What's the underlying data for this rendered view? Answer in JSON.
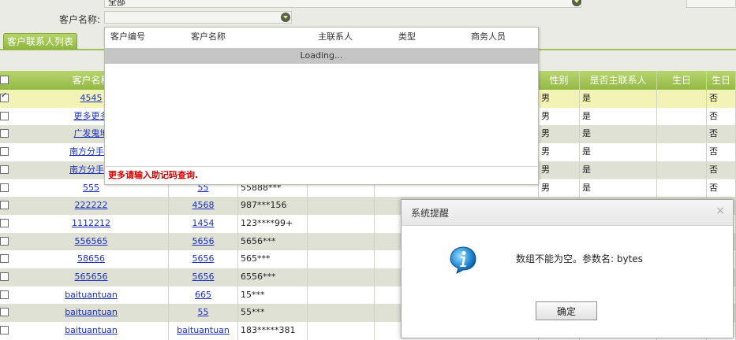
{
  "filters": {
    "region_value": "全部",
    "district_value": "全部",
    "customer_name_label": "客户名称:",
    "customer_name_value": ""
  },
  "tabs": {
    "active": "客户联系人列表"
  },
  "grid": {
    "headers": [
      "客户名称",
      "性别",
      "是否主联系人",
      "生日",
      "生日"
    ],
    "rows": [
      {
        "name": "4545",
        "code": "",
        "phone": "",
        "gender": "男",
        "primary": "是",
        "birthday": "",
        "flag": "否",
        "selected": true
      },
      {
        "name": "更多更多",
        "code": "",
        "phone": "",
        "gender": "男",
        "primary": "是",
        "birthday": "",
        "flag": "否",
        "selected": false
      },
      {
        "name": "广发鬼地",
        "code": "",
        "phone": "",
        "gender": "男",
        "primary": "是",
        "birthday": "",
        "flag": "否",
        "selected": false
      },
      {
        "name": "南方分手两",
        "code": "",
        "phone": "",
        "gender": "男",
        "primary": "是",
        "birthday": "",
        "flag": "否",
        "selected": false
      },
      {
        "name": "南方分手两",
        "code": "",
        "phone": "",
        "gender": "男",
        "primary": "是",
        "birthday": "",
        "flag": "否",
        "selected": false
      },
      {
        "name": "555",
        "code": "55",
        "phone": "55888***",
        "gender": "男",
        "primary": "是",
        "birthday": "",
        "flag": "否",
        "selected": false
      },
      {
        "name": "222222",
        "code": "4568",
        "phone": "987***156",
        "gender": "",
        "primary": "",
        "birthday": "",
        "flag": "",
        "selected": false
      },
      {
        "name": "1112212",
        "code": "1454",
        "phone": "123****99+",
        "gender": "",
        "primary": "",
        "birthday": "",
        "flag": "",
        "selected": false
      },
      {
        "name": "556565",
        "code": "5656",
        "phone": "5656***",
        "gender": "",
        "primary": "",
        "birthday": "",
        "flag": "",
        "selected": false
      },
      {
        "name": "58656",
        "code": "5656",
        "phone": "565***",
        "gender": "",
        "primary": "",
        "birthday": "",
        "flag": "",
        "selected": false
      },
      {
        "name": "565656",
        "code": "5656",
        "phone": "6556***",
        "gender": "",
        "primary": "",
        "birthday": "",
        "flag": "",
        "selected": false
      },
      {
        "name": "baituantuan",
        "code": "665",
        "phone": "15***",
        "gender": "",
        "primary": "",
        "birthday": "",
        "flag": "",
        "selected": false
      },
      {
        "name": "baituantuan",
        "code": "55",
        "phone": "55***",
        "gender": "",
        "primary": "",
        "birthday": "",
        "flag": "",
        "selected": false
      },
      {
        "name": "baituantuan",
        "code": "baituantuan",
        "phone": "183*****381",
        "gender": "",
        "primary": "",
        "birthday": "",
        "flag": "",
        "selected": false
      }
    ]
  },
  "dropdown": {
    "columns": [
      "客户编号",
      "客户名称",
      "主联系人",
      "类型",
      "商务人员"
    ],
    "loading": "Loading...",
    "footer": "更多请输入助记码查询."
  },
  "dialog": {
    "title": "系统提醒",
    "close": "×",
    "message": "数组不能为空。参数名: bytes",
    "ok": "确定"
  },
  "colors": {
    "header_green": "#93b845",
    "link": "#1a2fbf",
    "warning_red": "#d40000"
  }
}
